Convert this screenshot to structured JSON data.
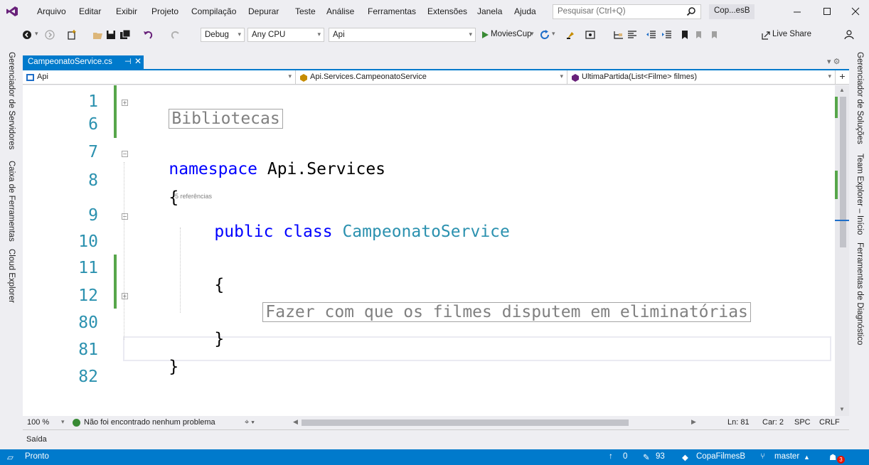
{
  "menu": {
    "items": [
      "Arquivo",
      "Editar",
      "Exibir",
      "Projeto",
      "Compilação",
      "Depurar",
      "Teste",
      "Análise",
      "Ferramentas",
      "Extensões",
      "Janela",
      "Ajuda"
    ],
    "search_placeholder": "Pesquisar (Ctrl+Q)",
    "solution_short": "Cop...esB"
  },
  "toolbar": {
    "config": "Debug",
    "platform": "Any CPU",
    "project": "Api",
    "run_target": "MoviesCup",
    "live_share": "Live Share"
  },
  "side_tabs": {
    "left": [
      "Gerenciador de Servidores",
      "Caixa de Ferramentas",
      "Cloud Explorer"
    ],
    "right": [
      "Gerenciador de Soluções",
      "Team Explorer – Início",
      "Ferramentas de Diagnóstico"
    ]
  },
  "document": {
    "tab_name": "CampeonatoService.cs",
    "nav_project": "Api",
    "nav_class": "Api.Services.CampeonatoService",
    "nav_member": "UltimaPartida(List<Filme> filmes)"
  },
  "code": {
    "line_numbers": [
      "1",
      "6",
      "7",
      "8",
      "9",
      "10",
      "11",
      "12",
      "80",
      "81",
      "82"
    ],
    "region_collapsed": "Bibliotecas",
    "kw_namespace": "namespace",
    "namespace_name": " Api.Services",
    "open_brace": "{",
    "references": "5 referências",
    "kw_public": "public",
    "kw_class": "class",
    "class_name": "CampeonatoService",
    "comment_collapsed": "Fazer com que os filmes disputem em eliminatórias",
    "close_brace": "}"
  },
  "editor_status": {
    "zoom": "100 %",
    "issues": "Não foi encontrado nenhum problema",
    "line": "Ln: 81",
    "col": "Car: 2",
    "spc": "SPC",
    "eol": "CRLF"
  },
  "output_tab": "Saída",
  "statusbar": {
    "state": "Pronto",
    "up_count": "0",
    "changes": "93",
    "repo": "CopaFilmesB",
    "branch": "master",
    "notifications": "3"
  },
  "colors": {
    "accent": "#007acc",
    "keyword": "#0000ff",
    "type": "#2b91af",
    "line_number": "#2b91af",
    "change_bar": "#57a64a"
  }
}
